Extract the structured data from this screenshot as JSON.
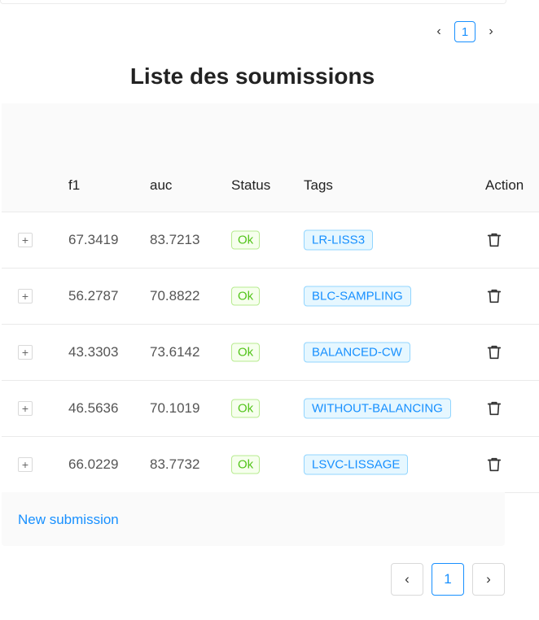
{
  "pagination_top": {
    "prev": "‹",
    "page": "1",
    "next": "›"
  },
  "title": "Liste des soumissions",
  "columns": {
    "f1": "f1",
    "auc": "auc",
    "status": "Status",
    "tags": "Tags",
    "action": "Action"
  },
  "rows": [
    {
      "f1": "67.3419",
      "auc": "83.7213",
      "status": "Ok",
      "tag": "LR-LISS3"
    },
    {
      "f1": "56.2787",
      "auc": "70.8822",
      "status": "Ok",
      "tag": "BLC-SAMPLING"
    },
    {
      "f1": "43.3303",
      "auc": "73.6142",
      "status": "Ok",
      "tag": "BALANCED-CW"
    },
    {
      "f1": "46.5636",
      "auc": "70.1019",
      "status": "Ok",
      "tag": "WITHOUT-BALANCING"
    },
    {
      "f1": "66.0229",
      "auc": "83.7732",
      "status": "Ok",
      "tag": "LSVC-LISSAGE"
    }
  ],
  "expand_symbol": "+",
  "footer": {
    "new_submission": "New submission"
  },
  "pagination_bottom": {
    "prev": "‹",
    "page": "1",
    "next": "›"
  },
  "colors": {
    "accent": "#1890ff",
    "success": "#52c41a"
  }
}
